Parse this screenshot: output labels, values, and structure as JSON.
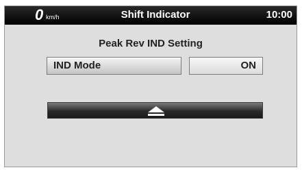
{
  "status_bar": {
    "speed_value": "0",
    "speed_unit": "km/h",
    "title": "Shift Indicator",
    "clock": "10:00"
  },
  "settings": {
    "heading": "Peak Rev IND Setting",
    "mode_label": "IND Mode",
    "mode_value": "ON"
  },
  "navigation": {
    "back_icon": "eject-up-arrow-icon"
  }
}
